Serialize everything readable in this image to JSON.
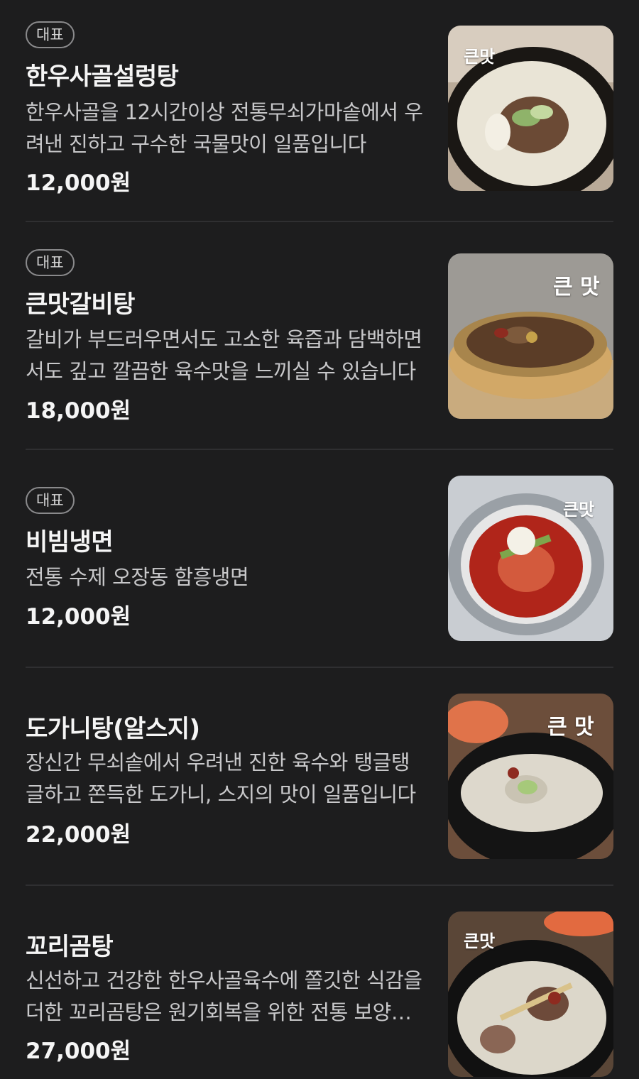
{
  "menu": {
    "items": [
      {
        "badge": "대표",
        "name": "한우사골설렁탕",
        "description": "한우사골을 12시간이상 전통무쇠가마솥에서 우려낸 진하고 구수한 국물맛이 일품입니다",
        "price": "12,000원",
        "image_logo": "큰맛"
      },
      {
        "badge": "대표",
        "name": "큰맛갈비탕",
        "description": "갈비가 부드러우면서도 고소한 육즙과 담백하면서도 깊고 깔끔한 육수맛을 느끼실 수 있습니다",
        "price": "18,000원",
        "image_logo": "큰 맛"
      },
      {
        "badge": "대표",
        "name": "비빔냉면",
        "description": "전통 수제 오장동 함흥냉면",
        "price": "12,000원",
        "image_logo": "큰맛"
      },
      {
        "name": "도가니탕(알스지)",
        "description": "장신간 무쇠솥에서 우려낸 진한 육수와 탱글탱글하고 쫀득한 도가니, 스지의 맛이 일품입니다",
        "price": "22,000원",
        "image_logo": "큰 맛"
      },
      {
        "name": "꼬리곰탕",
        "description": "신선하고 건강한 한우사골육수에 쫄깃한 식감을 더한 꼬리곰탕은 원기회복을 위한 전통 보양식입니다",
        "price": "27,000원",
        "image_logo": "큰맛"
      }
    ]
  }
}
